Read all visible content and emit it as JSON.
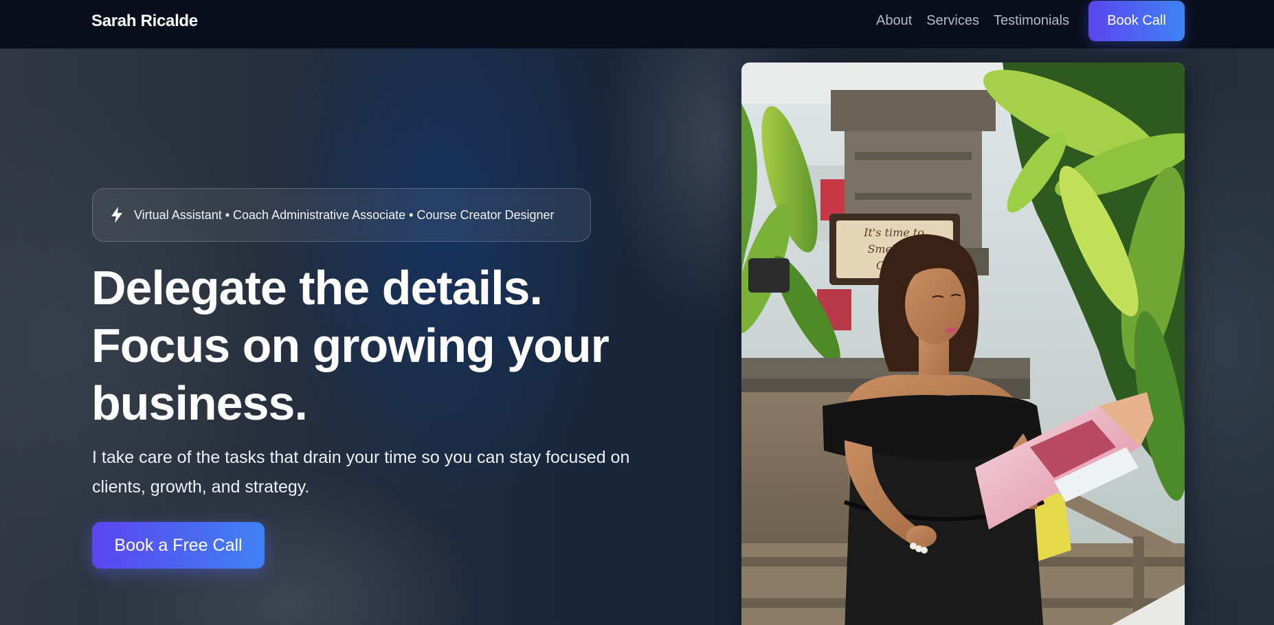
{
  "nav": {
    "brand": "Sarah Ricalde",
    "links": [
      "About",
      "Services",
      "Testimonials"
    ],
    "cta": "Book Call"
  },
  "hero": {
    "badge_icon": "lightning-bolt-icon",
    "badge": "Virtual Assistant • Coach Administrative Associate • Course Creator Designer",
    "headline": [
      "Delegate the details.",
      "Focus on growing your",
      "business."
    ],
    "subtext": "I take care of the tasks that drain your time so you can stay focused on clients, growth, and strategy.",
    "cta": "Book a Free Call"
  },
  "photo": {
    "sign_text": [
      "It's time to",
      "Smell the",
      "Coffee"
    ]
  },
  "colors": {
    "nav_bg": "#0a0e1c",
    "accent_start": "#5b45ee",
    "accent_end": "#3f82f5"
  }
}
